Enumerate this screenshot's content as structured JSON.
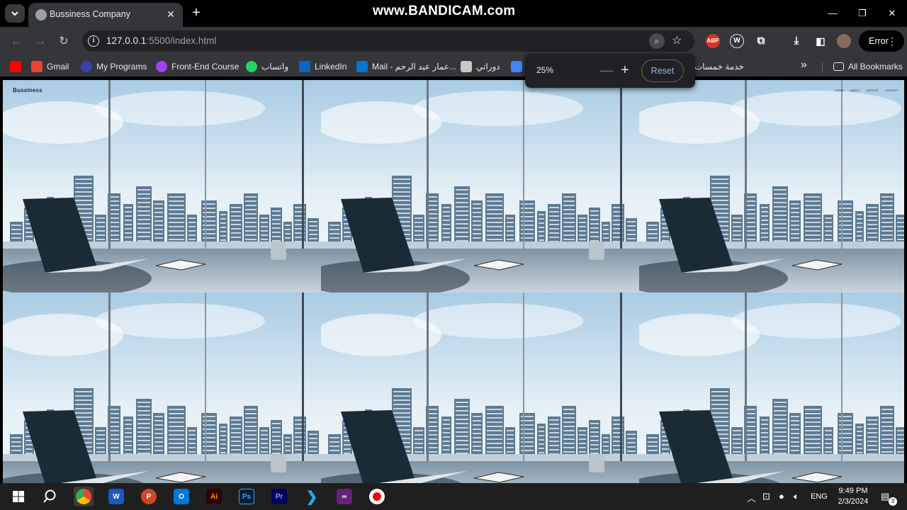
{
  "browser": {
    "tab_title": "Bussiness Company",
    "url_host": "127.0.0.1",
    "url_rest": ":5500/index.html",
    "error_label": "Error",
    "watermark": "www.BANDICAM.com"
  },
  "bookmarks": [
    {
      "label": "",
      "icon": "youtube-icon",
      "color": "#ff0000"
    },
    {
      "label": "Gmail",
      "icon": "gmail-icon",
      "color": "#ea4335"
    },
    {
      "label": "My Programs",
      "icon": "programs-icon",
      "color": "#3b3fb0"
    },
    {
      "label": "Front-End Course",
      "icon": "course-icon",
      "color": "#a142f4"
    },
    {
      "label": "واتساب",
      "icon": "whatsapp-icon",
      "color": "#25d366"
    },
    {
      "label": "LinkedIn",
      "icon": "linkedin-icon",
      "color": "#0a66c2"
    },
    {
      "label": "Mail - عمار عبد الرحم...",
      "icon": "outlook-icon",
      "color": "#0078d4"
    },
    {
      "label": "دوراتي",
      "icon": "folder-icon",
      "color": "#c8c8c8"
    },
    {
      "label": "خدمة خمسات",
      "icon": "khamsat-icon",
      "color": "#35363a"
    }
  ],
  "bookmarks_all": "All Bookmarks",
  "zoom": {
    "level": "25%",
    "minus": "—",
    "plus": "+",
    "reset": "Reset"
  },
  "site": {
    "logo": "Bussiness",
    "nav": [
      "HOME",
      "ABOUT",
      "SERVICE",
      "CONTACT"
    ]
  },
  "taskbar": {
    "time": "9:49 PM",
    "date": "2/3/2024",
    "lang": "ENG",
    "notif_count": "3"
  }
}
